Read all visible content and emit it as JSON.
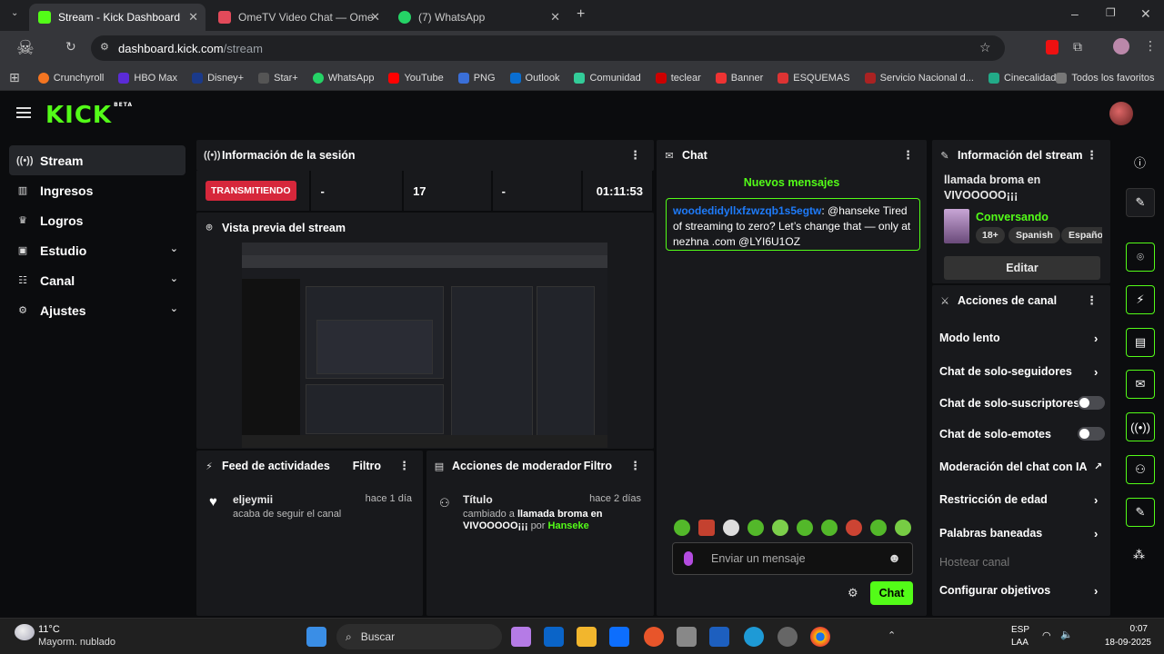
{
  "browser": {
    "tabs": [
      {
        "title": "Stream - Kick Dashboard",
        "active": true
      },
      {
        "title": "OmeTV Video Chat — Ome"
      },
      {
        "title": "(7) WhatsApp"
      }
    ],
    "url_host": "dashboard.kick.com",
    "url_path": "/stream",
    "bookmarks": [
      "Crunchyroll",
      "HBO Max",
      "Disney+",
      "Star+",
      "WhatsApp",
      "YouTube",
      "PNG",
      "Outlook",
      "Comunidad",
      "teclear",
      "Banner",
      "ESQUEMAS",
      "Servicio Nacional d...",
      "Cinecalidad"
    ],
    "all_bookmarks": "Todos los favoritos"
  },
  "kick": {
    "logo": "KICK",
    "beta": "BETA",
    "sidebar": [
      {
        "label": "Stream",
        "icon": "broadcast-icon"
      },
      {
        "label": "Ingresos",
        "icon": "chart-icon"
      },
      {
        "label": "Logros",
        "icon": "trophy-icon"
      },
      {
        "label": "Estudio",
        "icon": "studio-icon"
      },
      {
        "label": "Canal",
        "icon": "channel-icon"
      },
      {
        "label": "Ajustes",
        "icon": "gear-icon"
      }
    ],
    "session": {
      "title": "Información de la sesión",
      "status": "TRANSMITIENDO",
      "stat1": "-",
      "viewers": "17",
      "stat3": "-",
      "time": "01:11:53"
    },
    "preview_title": "Vista previa del stream",
    "feed": {
      "title": "Feed de actividades",
      "filter": "Filtro",
      "user": "eljeymii",
      "time": "hace 1 día",
      "action": "acaba de seguir el canal"
    },
    "mod": {
      "title": "Acciones de moderador",
      "filter": "Filtro",
      "field": "Título",
      "time": "hace 2 días",
      "changed": "cambiado a",
      "value": "llamada broma en VIVOOOOO¡¡¡",
      "by": "por",
      "moderator": "Hanseke"
    },
    "chat": {
      "title": "Chat",
      "new_messages": "Nuevos mensajes",
      "msg_user": "woodedidyllxfzwzqb1s5egtw",
      "msg_text": ": @hanseke Tired of streaming to zero? Let’s change that — only at nezhna .com @LYI6U1OZ",
      "placeholder": "Enviar un mensaje",
      "send": "Chat"
    },
    "stream_info": {
      "title": "Información del stream",
      "stream_title": "llamada broma en VIVOOOOO¡¡¡",
      "category": "Conversando",
      "tags": [
        "18+",
        "Spanish",
        "Españo"
      ],
      "edit": "Editar"
    },
    "channel_actions": {
      "title": "Acciones de canal",
      "items": [
        "Modo lento",
        "Chat de solo-seguidores",
        "Chat de solo-suscriptores",
        "Chat de solo-emotes",
        "Moderación del chat con IA",
        "Restricción de edad",
        "Palabras baneadas",
        "Hostear canal",
        "Configurar objetivos"
      ]
    }
  },
  "taskbar": {
    "temp": "11°C",
    "weather": "Mayorm. nublado",
    "search": "Buscar",
    "lang1": "ESP",
    "lang2": "LAA",
    "time": "0:07",
    "date": "18-09-2025"
  }
}
